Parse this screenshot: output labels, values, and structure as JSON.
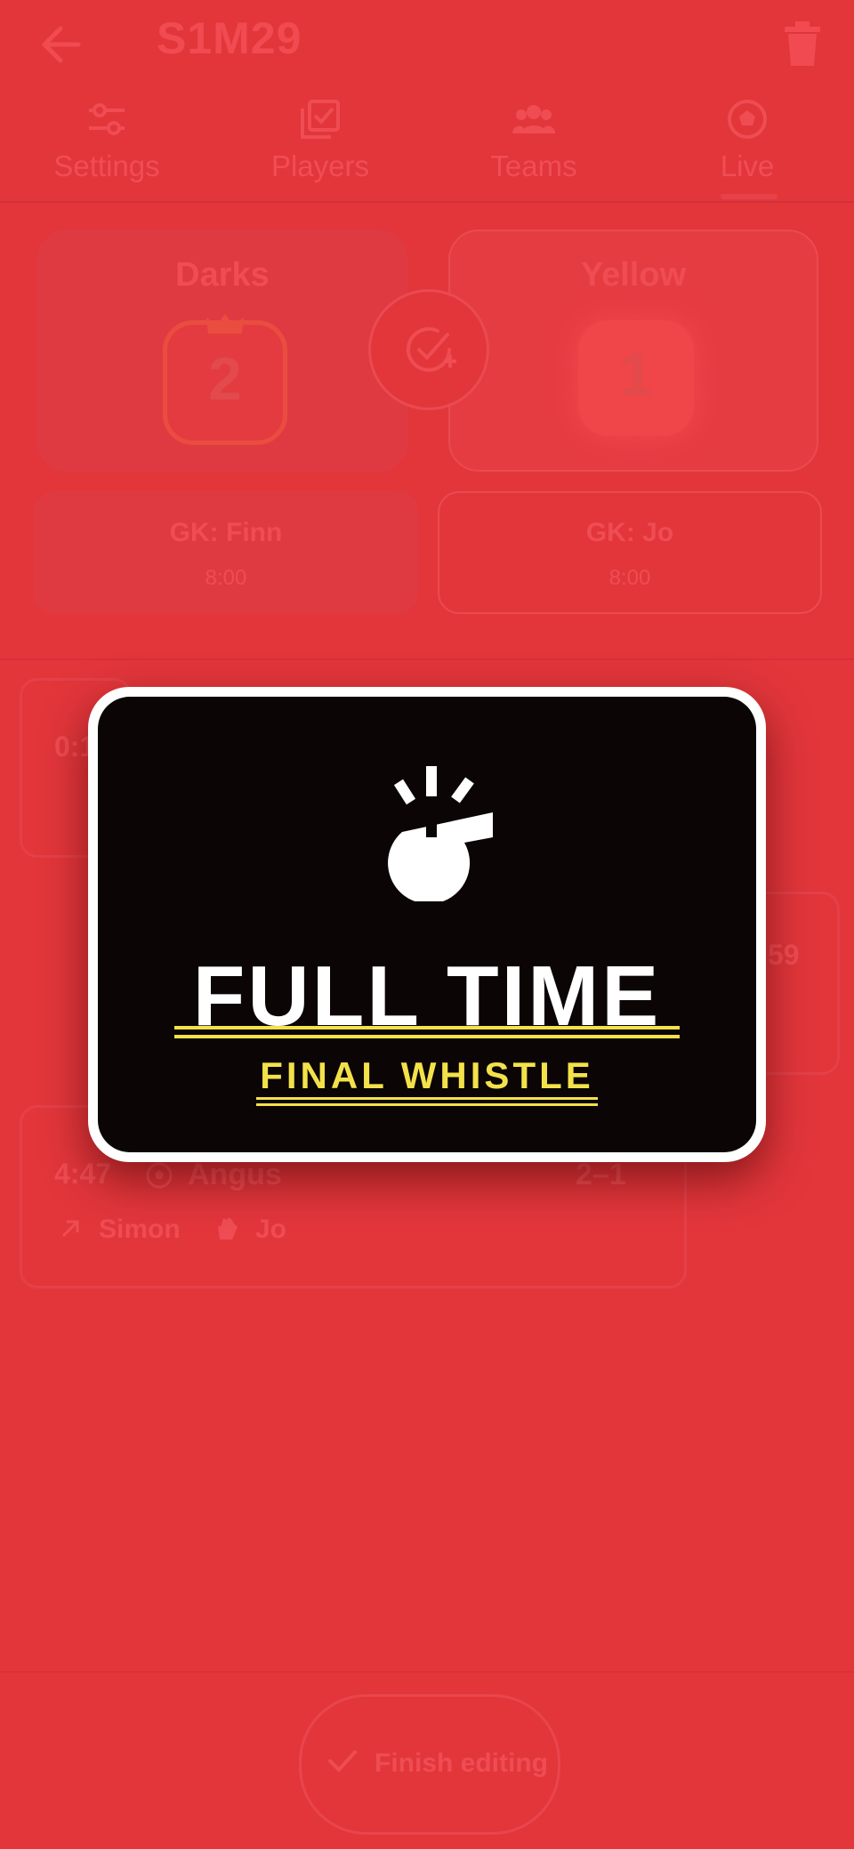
{
  "header": {
    "title": "S1M29",
    "back_icon": "arrow-left-icon",
    "delete_icon": "trash-icon"
  },
  "tabs": [
    {
      "label": "Settings",
      "icon": "sliders-icon"
    },
    {
      "label": "Players",
      "icon": "checklist-icon"
    },
    {
      "label": "Teams",
      "icon": "group-icon"
    },
    {
      "label": "Live",
      "icon": "football-icon",
      "selected": true
    }
  ],
  "scoreboard": {
    "left": {
      "name": "Darks",
      "score": "2",
      "leading": true
    },
    "right": {
      "name": "Yellow",
      "score": "1"
    },
    "swap_icon": "check-plus-circle-icon"
  },
  "goalkeepers": {
    "left": {
      "label": "GK: Finn",
      "time": "8:00"
    },
    "right": {
      "label": "GK: Jo",
      "time": "8:00"
    }
  },
  "events": [
    {
      "time": "0:1",
      "scorer": "",
      "score": ""
    },
    {
      "time": "59",
      "scorer": "",
      "score": ""
    },
    {
      "time": "4:47",
      "scorer": "Angus",
      "score": "2–1",
      "assist": "Simon",
      "keeper": "Jo"
    }
  ],
  "bottom": {
    "finish_label": "Finish editing"
  },
  "overlay": {
    "icon": "whistle-icon",
    "title": "FULL TIME",
    "subtitle": "FINAL WHISTLE"
  },
  "colors": {
    "background": "#e2363b",
    "modal_bg": "#0b0506",
    "accent_yellow": "#f3e14a"
  }
}
